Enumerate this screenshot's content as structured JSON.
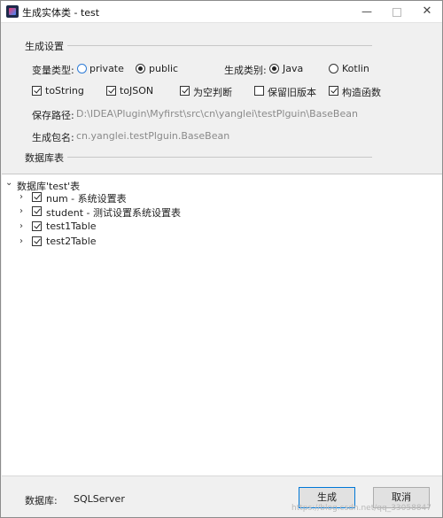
{
  "window": {
    "title": "生成实体类 - test",
    "controls": {
      "minimize": "—",
      "maximize": "",
      "close": "✕"
    }
  },
  "settings": {
    "section_title": "生成设置",
    "var_type": {
      "label": "变量类型:",
      "options": [
        {
          "label": "private",
          "selected": false
        },
        {
          "label": "public",
          "selected": true
        }
      ]
    },
    "gen_type": {
      "label": "生成类别:",
      "options": [
        {
          "label": "Java",
          "selected": true
        },
        {
          "label": "Kotlin",
          "selected": false
        }
      ]
    },
    "checkboxes": [
      {
        "label": "toString",
        "checked": true
      },
      {
        "label": "toJSON",
        "checked": true
      },
      {
        "label": "为空判断",
        "checked": true
      },
      {
        "label": "保留旧版本",
        "checked": false
      },
      {
        "label": "构造函数",
        "checked": true
      }
    ],
    "save_path": {
      "label": "保存路径:",
      "value": "D:\\IDEA\\Plugin\\Myfirst\\src\\cn\\yanglei\\testPlguin\\BaseBean"
    },
    "package_name": {
      "label": "生成包名:",
      "value": "cn.yanglei.testPlguin.BaseBean"
    }
  },
  "database": {
    "section_title": "数据库表",
    "root_label": "数据库'test'表",
    "tables": [
      {
        "label": "num - 系统设置表",
        "checked": true
      },
      {
        "label": "student - 测试设置系统设置表",
        "checked": true
      },
      {
        "label": "test1Table",
        "checked": true
      },
      {
        "label": "test2Table",
        "checked": true
      }
    ]
  },
  "footer": {
    "db_label": "数据库:",
    "db_value": "SQLServer",
    "generate_button": "生成",
    "cancel_button": "取消",
    "watermark": "https://blog.csdn.net/qq_33058847"
  }
}
